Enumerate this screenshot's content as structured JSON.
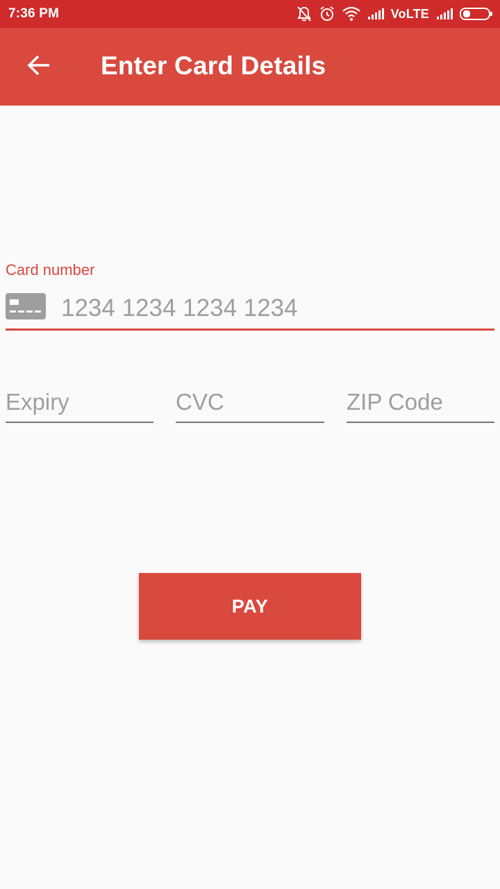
{
  "status_bar": {
    "time": "7:36 PM",
    "network_label": "VoLTE",
    "background_color": "#cf2b2b",
    "icons": [
      "bell-off-icon",
      "alarm-icon",
      "wifi-icon",
      "signal-icon",
      "signal-icon",
      "battery-icon"
    ]
  },
  "app_bar": {
    "title": "Enter Card Details",
    "background_color": "#d9493e",
    "back_icon": "arrow-left-icon"
  },
  "form": {
    "card_number": {
      "label": "Card number",
      "placeholder": "1234 1234 1234 1234",
      "value": "",
      "icon": "credit-card-icon"
    },
    "expiry": {
      "placeholder": "Expiry",
      "value": ""
    },
    "cvc": {
      "placeholder": "CVC",
      "value": ""
    },
    "zip": {
      "placeholder": "ZIP Code",
      "value": ""
    },
    "accent_color": "#d9493e"
  },
  "pay_button": {
    "label": "PAY"
  }
}
